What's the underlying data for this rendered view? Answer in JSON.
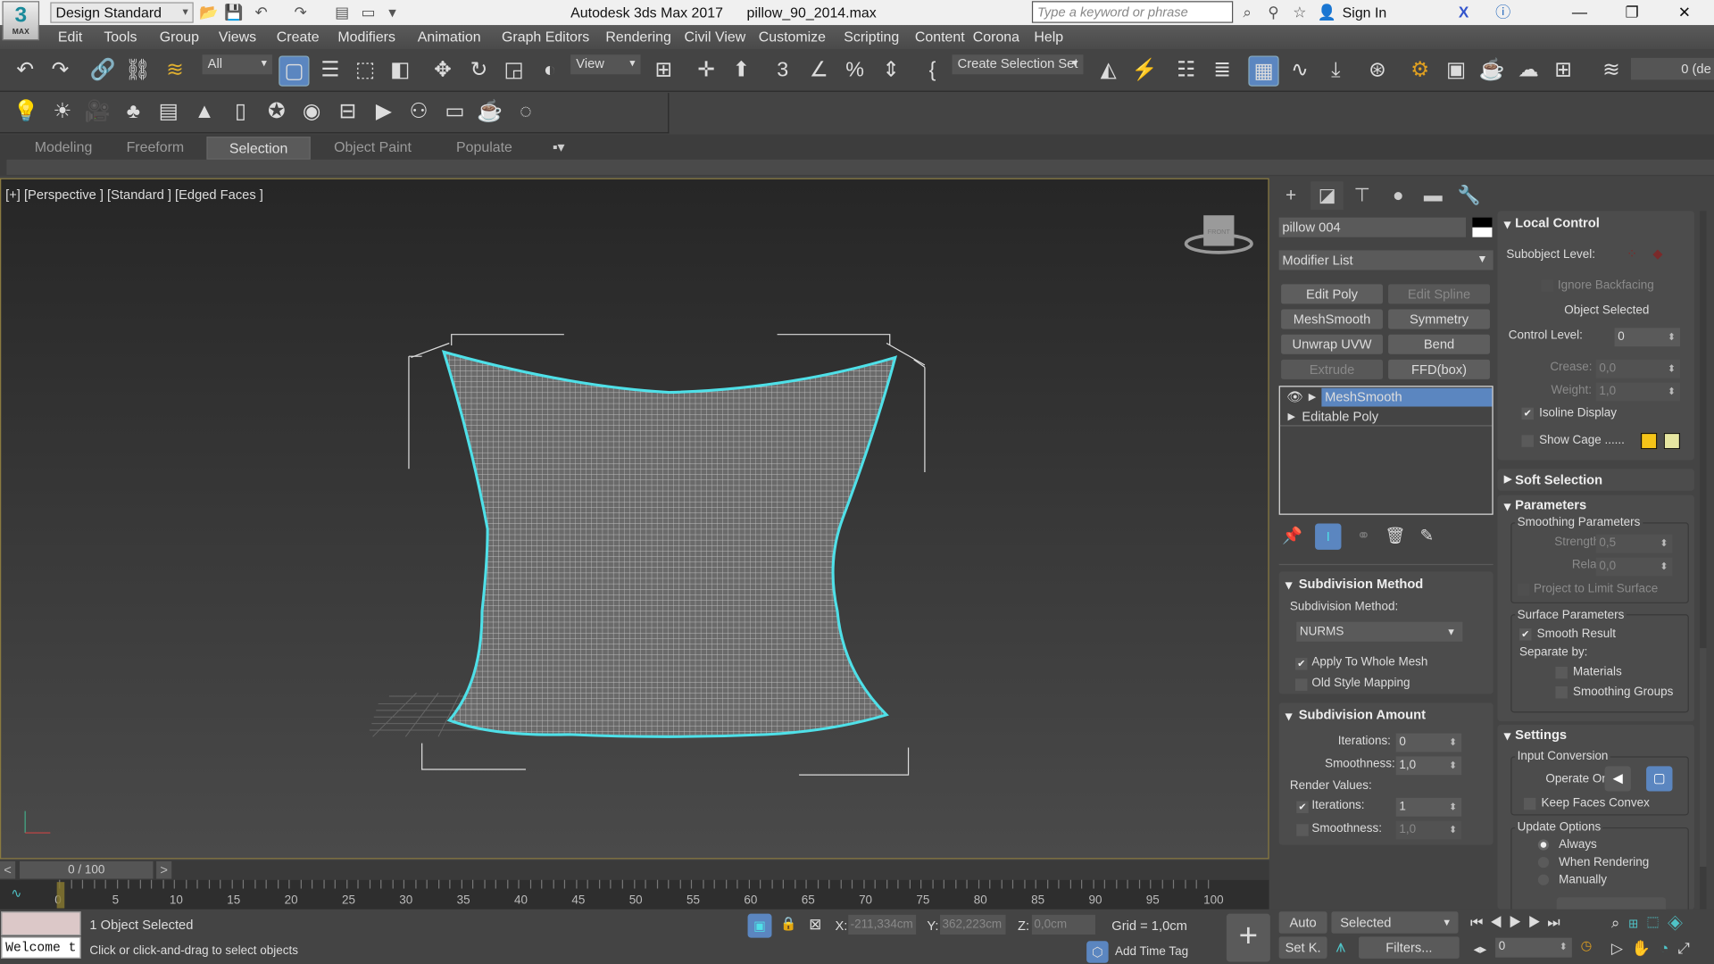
{
  "titlebar": {
    "logo": "3",
    "logo_sub": "MAX",
    "workspace": "Design Standard",
    "app_title": "Autodesk 3ds Max 2017",
    "file_name": "pillow_90_2014.max",
    "search_placeholder": "Type a keyword or phrase",
    "sign_in": "Sign In"
  },
  "menu": [
    "Edit",
    "Tools",
    "Group",
    "Views",
    "Create",
    "Modifiers",
    "Animation",
    "Graph Editors",
    "Rendering",
    "Civil View",
    "Customize",
    "Scripting",
    "Content",
    "Corona",
    "Help"
  ],
  "toolbar": {
    "selection_filter": "All",
    "ref_coord": "View",
    "selection_set": "Create Selection Set",
    "layer": "0 (de"
  },
  "ribbon": {
    "tabs": [
      "Modeling",
      "Freeform",
      "Selection",
      "Object Paint",
      "Populate"
    ],
    "active": "Selection"
  },
  "viewport": {
    "label": "[+] [Perspective ] [Standard ] [Edged Faces ]",
    "viewcube": "FRONT",
    "accent": "#4fe0e8"
  },
  "command_panel": {
    "object_name": "pillow 004",
    "modifier_list": "Modifier List",
    "modifier_buttons": [
      {
        "label": "Edit Poly",
        "enabled": true
      },
      {
        "label": "Edit Spline",
        "enabled": false
      },
      {
        "label": "MeshSmooth",
        "enabled": true
      },
      {
        "label": "Symmetry",
        "enabled": true
      },
      {
        "label": "Unwrap UVW",
        "enabled": true
      },
      {
        "label": "Bend",
        "enabled": true
      },
      {
        "label": "Extrude",
        "enabled": false
      },
      {
        "label": "FFD(box)",
        "enabled": true
      }
    ],
    "stack": [
      "MeshSmooth",
      "Editable Poly"
    ],
    "subdivision_method": {
      "title": "Subdivision Method",
      "label": "Subdivision Method:",
      "value": "NURMS",
      "apply_whole_mesh": "Apply To Whole Mesh",
      "old_style_mapping": "Old Style Mapping"
    },
    "subdivision_amount": {
      "title": "Subdivision Amount",
      "iterations_label": "Iterations:",
      "iterations": "0",
      "smoothness_label": "Smoothness:",
      "smoothness": "1,0",
      "render_values": "Render Values:",
      "render_iterations_label": "Iterations:",
      "render_iterations": "1",
      "render_smoothness_label": "Smoothness:",
      "render_smoothness": "1,0"
    },
    "local_control": {
      "title": "Local Control",
      "subobject_level": "Subobject Level:",
      "ignore_backfacing": "Ignore Backfacing",
      "object_selected": "Object Selected",
      "control_level_label": "Control Level:",
      "control_level": "0",
      "crease_label": "Crease:",
      "crease": "0,0",
      "weight_label": "Weight:",
      "weight": "1,0",
      "isoline": "Isoline Display",
      "show_cage": "Show Cage ......",
      "cage_color1": "#f5c518",
      "cage_color2": "#e6e6a0"
    },
    "soft_selection": {
      "title": "Soft Selection"
    },
    "parameters": {
      "title": "Parameters",
      "smoothing_params": "Smoothing Parameters",
      "strength_label": "Strength:",
      "strength": "0,5",
      "relax_label": "Relax:",
      "relax": "0,0",
      "project": "Project to Limit Surface",
      "surface_params": "Surface Parameters",
      "smooth_result": "Smooth Result",
      "separate_by": "Separate by:",
      "materials": "Materials",
      "smoothing_groups": "Smoothing Groups"
    },
    "settings": {
      "title": "Settings",
      "input_conversion": "Input Conversion",
      "operate_on": "Operate On:",
      "keep_convex": "Keep Faces Convex",
      "update_options": "Update Options",
      "always": "Always",
      "when_rendering": "When Rendering",
      "manually": "Manually"
    }
  },
  "timeline": {
    "frame": "0 / 100",
    "ticks": [
      "0",
      "5",
      "10",
      "15",
      "20",
      "25",
      "30",
      "35",
      "40",
      "45",
      "50",
      "55",
      "60",
      "65",
      "70",
      "75",
      "80",
      "85",
      "90",
      "95",
      "100"
    ]
  },
  "status": {
    "welcome": "Welcome t",
    "selected": "1 Object Selected",
    "prompt": "Click or click-and-drag to select objects",
    "x_label": "X:",
    "x": "-211,334cm",
    "y_label": "Y:",
    "y": "362,223cm",
    "z_label": "Z:",
    "z": "0,0cm",
    "grid": "Grid = 1,0cm",
    "add_time_tag": "Add Time Tag",
    "auto": "Auto",
    "set_key": "Set K.",
    "key_filter": "Selected",
    "filters": "Filters...",
    "current_frame": "0"
  }
}
